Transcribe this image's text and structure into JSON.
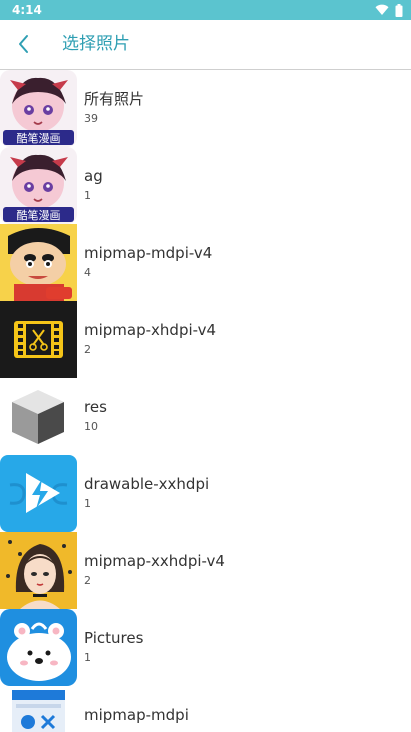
{
  "status_bar": {
    "time": "4:14",
    "icons": [
      "wifi-icon",
      "battery-icon"
    ],
    "color": "#5bc4cf"
  },
  "app_bar": {
    "title": "选择照片",
    "back_icon": "chevron-left-icon",
    "accent_color": "#2f9fb3"
  },
  "albums": [
    {
      "name": "所有照片",
      "count": "39"
    },
    {
      "name": "ag",
      "count": "1"
    },
    {
      "name": "mipmap-mdpi-v4",
      "count": "4"
    },
    {
      "name": "mipmap-xhdpi-v4",
      "count": "2"
    },
    {
      "name": "res",
      "count": "10"
    },
    {
      "name": "drawable-xxhdpi",
      "count": "1"
    },
    {
      "name": "mipmap-xxhdpi-v4",
      "count": "2"
    },
    {
      "name": "Pictures",
      "count": "1"
    },
    {
      "name": "mipmap-mdpi",
      "count": ""
    }
  ],
  "thumb_labels": {
    "comic": "酷笔漫画"
  }
}
